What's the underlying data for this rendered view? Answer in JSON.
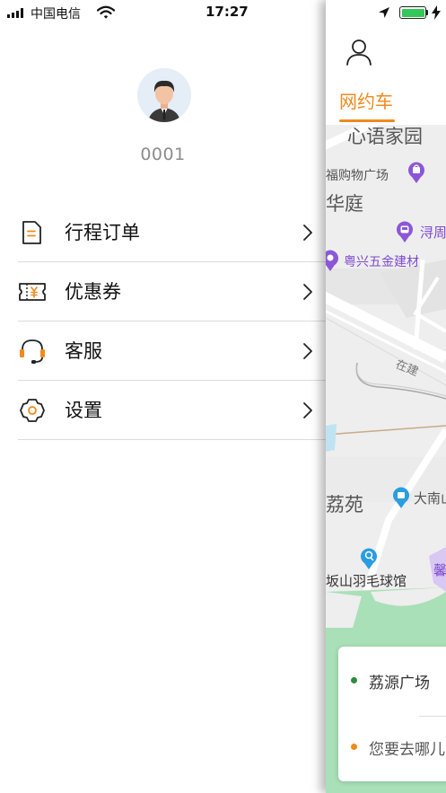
{
  "status_bar": {
    "carrier": "中国电信",
    "time": "17:27"
  },
  "drawer": {
    "username": "0001",
    "menu": [
      {
        "label": "行程订单",
        "icon": "trip-order-icon"
      },
      {
        "label": "优惠券",
        "icon": "coupon-icon"
      },
      {
        "label": "客服",
        "icon": "headset-icon"
      },
      {
        "label": "设置",
        "icon": "gear-icon"
      }
    ]
  },
  "main": {
    "tab_label": "网约车",
    "map_labels": {
      "community": "心语家园",
      "mall": "福购物广场",
      "huating": "华庭",
      "xunzhou": "浔周",
      "hardware": "粤兴五金建材",
      "under_construction": "在建",
      "liyuan": "荔苑",
      "danan": "大南山",
      "badminton": "坂山羽毛球馆",
      "edge_char": "馨"
    },
    "pickup": "荔源广场",
    "destination_placeholder": "您要去哪儿"
  },
  "colors": {
    "accent": "#f08a1c",
    "poi_purple": "#8b57d8",
    "poi_blue": "#2a9de0",
    "pickup_dot": "#2e8b3d",
    "destination_dot": "#f08a1c",
    "battery": "#34c759"
  }
}
